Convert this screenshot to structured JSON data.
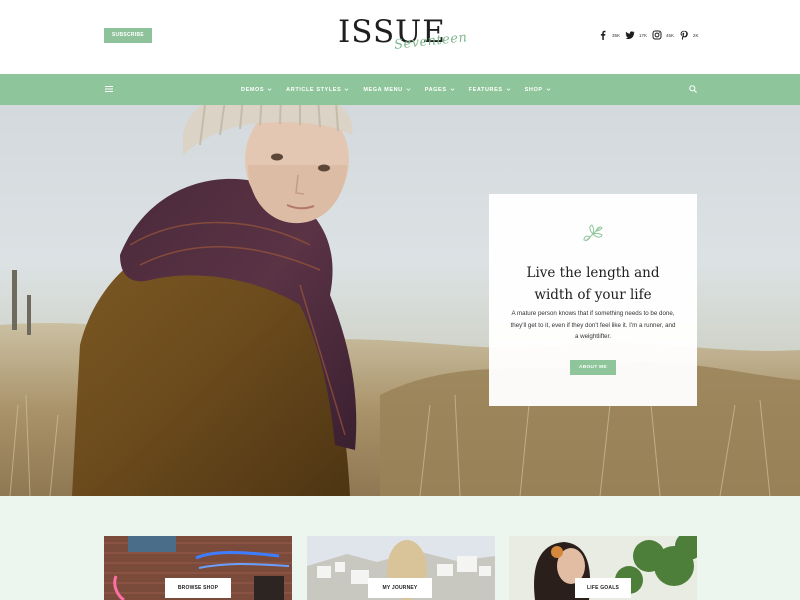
{
  "header": {
    "subscribe_label": "SUBSCRIBE",
    "logo_main": "ISSUE",
    "logo_script": "Seventeen",
    "social": [
      {
        "icon": "facebook-icon",
        "count": "35K"
      },
      {
        "icon": "twitter-icon",
        "count": "17K"
      },
      {
        "icon": "instagram-icon",
        "count": "45K"
      },
      {
        "icon": "pinterest-icon",
        "count": "2K"
      }
    ]
  },
  "nav": {
    "items": [
      {
        "label": "DEMOS"
      },
      {
        "label": "ARTICLE STYLES"
      },
      {
        "label": "MEGA MENU"
      },
      {
        "label": "PAGES"
      },
      {
        "label": "FEATURES"
      },
      {
        "label": "SHOP"
      }
    ]
  },
  "hero": {
    "title_line1": "Live the length and",
    "title_line2": "width of your life",
    "text": "A mature person knows that if something needs to be done, they'll get to it, even if they don't feel like it. I'm a runner, and a weightlifter.",
    "button_label": "ABOUT ME"
  },
  "cards": [
    {
      "label": "BROWSE SHOP"
    },
    {
      "label": "MY JOURNEY"
    },
    {
      "label": "LIFE GOALS"
    }
  ],
  "colors": {
    "accent": "#8ec59b",
    "logo_script": "#7fb88f",
    "below_bg": "#edf5ef"
  }
}
